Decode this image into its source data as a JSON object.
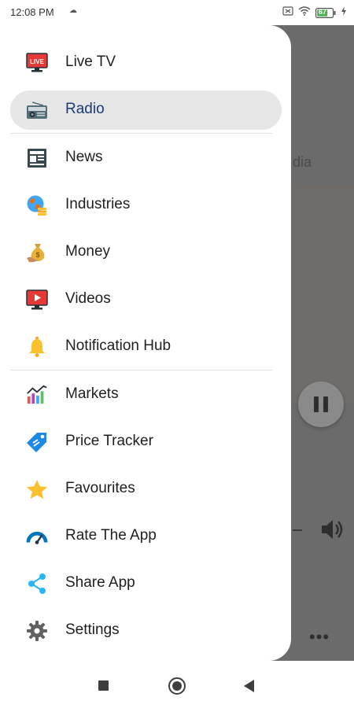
{
  "status_bar": {
    "time": "12:08 PM",
    "indicator": "☁",
    "battery_label": "67"
  },
  "drawer": {
    "items": [
      {
        "label": "Live TV",
        "icon": "live-tv-icon"
      },
      {
        "label": "Radio",
        "icon": "radio-icon",
        "active": true
      },
      {
        "label": "News",
        "icon": "news-icon"
      },
      {
        "label": "Industries",
        "icon": "industries-icon"
      },
      {
        "label": "Money",
        "icon": "money-bag-icon"
      },
      {
        "label": "Videos",
        "icon": "video-icon"
      },
      {
        "label": "Notification Hub",
        "icon": "bell-icon"
      },
      {
        "label": "Markets",
        "icon": "markets-chart-icon"
      },
      {
        "label": "Price Tracker",
        "icon": "price-tag-icon"
      },
      {
        "label": "Favourites",
        "icon": "star-icon"
      },
      {
        "label": "Rate The App",
        "icon": "gauge-icon"
      },
      {
        "label": "Share App",
        "icon": "share-icon"
      },
      {
        "label": "Settings",
        "icon": "gear-icon"
      }
    ]
  },
  "background": {
    "tab_text_fragment": "dia",
    "more_label": "•••"
  },
  "colors": {
    "active_item_bg": "#e6e6e6",
    "active_item_text": "#1a3a7a",
    "scrim": "#6b6b6b"
  }
}
